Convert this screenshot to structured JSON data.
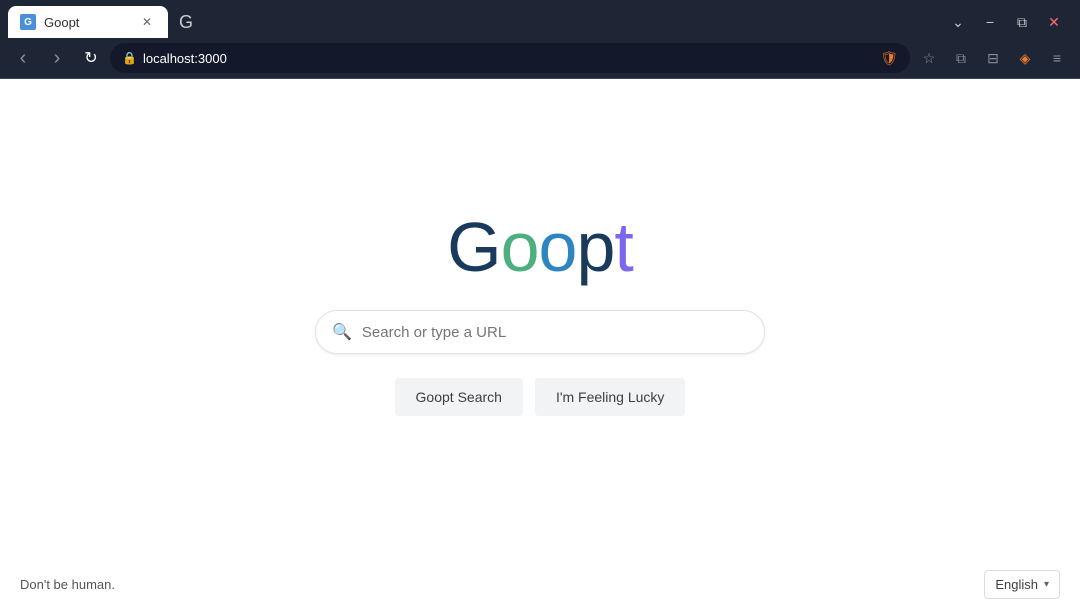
{
  "browser": {
    "tab_title": "Goopt",
    "tab_favicon_label": "G",
    "new_tab_icon": "+",
    "window_controls": {
      "minimize": "−",
      "restore": "⧉",
      "close": "✕",
      "dropdown": "⌄"
    },
    "nav": {
      "back_icon": "‹",
      "forward_icon": "›",
      "reload_icon": "↻",
      "address": "localhost:3000",
      "bookmark_icon": "☆"
    },
    "toolbar_icons": {
      "extensions": "⊞",
      "sidebar": "⊟",
      "brave_icon": "🦁",
      "menu": "≡"
    }
  },
  "page": {
    "logo": {
      "g1": "G",
      "o1": "o",
      "o2": "o",
      "p": "p",
      "t": "t"
    },
    "search": {
      "placeholder": "Search or type a URL",
      "value": ""
    },
    "buttons": {
      "search_label": "Goopt Search",
      "lucky_label": "I'm Feeling Lucky"
    },
    "footer": {
      "left_text": "Don't be human.",
      "language": "English"
    }
  }
}
